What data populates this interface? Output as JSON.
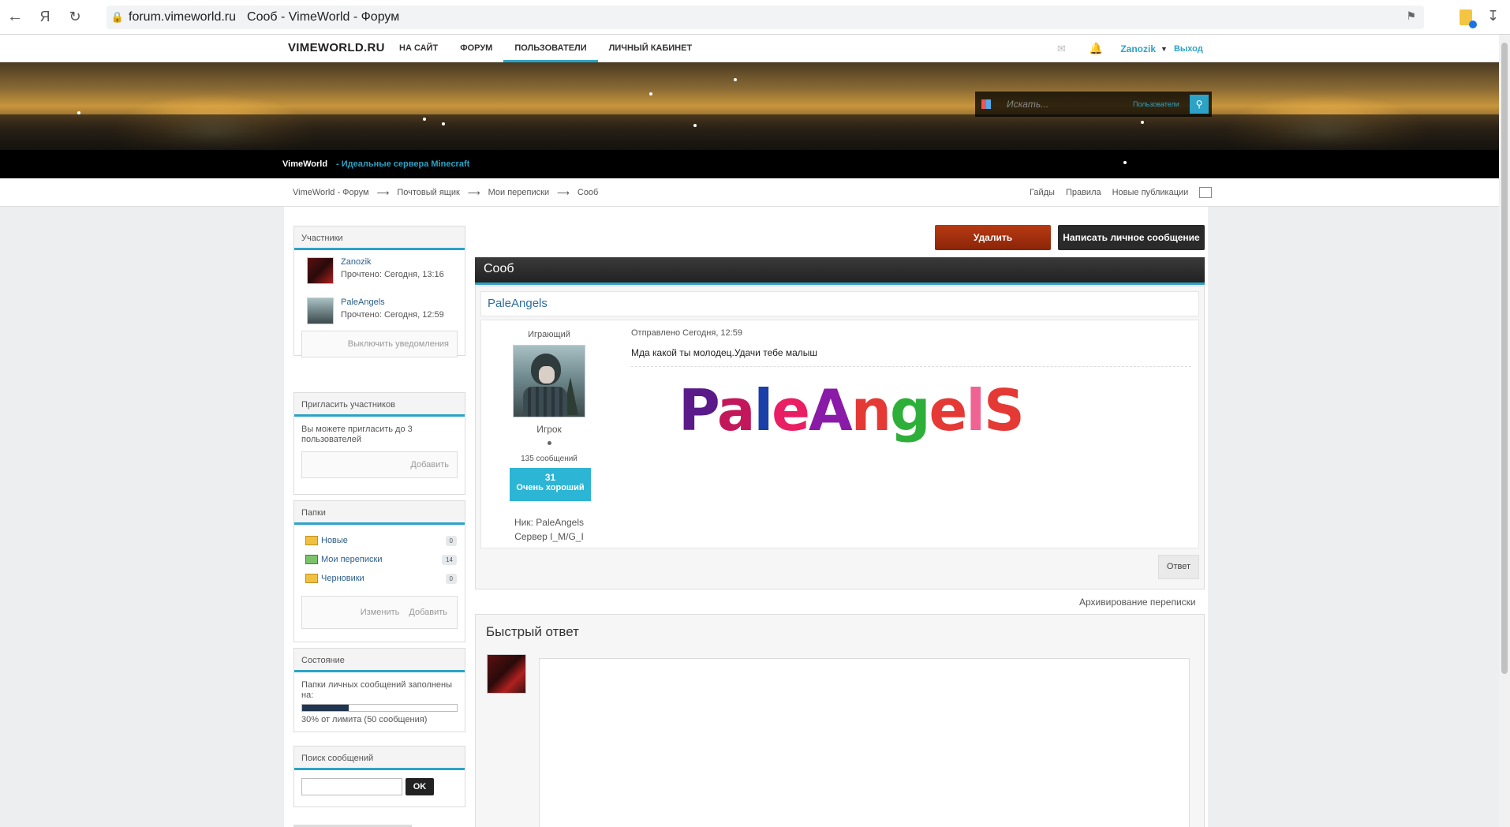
{
  "browser": {
    "domain": "forum.vimeworld.ru",
    "tab_title": "Сооб - VimeWorld - Форум",
    "back_icon": "arrow-left-icon",
    "yandex_icon": "Я",
    "reload_icon": "↻"
  },
  "topnav": {
    "logo": "VIMEWORLD.RU",
    "menu": [
      "НА САЙТ",
      "ФОРУМ",
      "ПОЛЬЗОВАТЕЛИ",
      "ЛИЧНЫЙ КАБИНЕТ"
    ],
    "active_index": 2,
    "username": "Zanozik",
    "logout": "Выход"
  },
  "banner": {
    "search_placeholder": "Искать...",
    "search_scope": "Пользователи",
    "site_name": "VimeWorld",
    "tagline": "- Идеальные сервера Minecraft"
  },
  "breadcrumbs": [
    "VimeWorld - Форум",
    "Почтовый ящик",
    "Мои переписки",
    "Сооб"
  ],
  "breadcrumb_links": [
    "Гайды",
    "Правила",
    "Новые публикации"
  ],
  "sidebar": {
    "participants": {
      "title": "Участники",
      "items": [
        {
          "name": "Zanozik",
          "seen": "Прочтено: Сегодня, 13:16"
        },
        {
          "name": "PaleAngels",
          "seen": "Прочтено: Сегодня, 12:59"
        }
      ],
      "mute_button": "Выключить уведомления"
    },
    "invite": {
      "title": "Пригласить участников",
      "text": "Вы можете пригласить до 3 пользователей",
      "add_button": "Добавить"
    },
    "folders": {
      "title": "Папки",
      "items": [
        {
          "name": "Новые",
          "count": "0"
        },
        {
          "name": "Мои переписки",
          "count": "14"
        },
        {
          "name": "Черновики",
          "count": "0"
        }
      ],
      "edit_button": "Изменить",
      "add_button": "Добавить"
    },
    "status": {
      "title": "Состояние",
      "text": "Папки личных сообщений заполнены на:",
      "percent": 30,
      "limit_text": "30% от лимита (50 сообщения)"
    },
    "search": {
      "title": "Поиск сообщений",
      "ok": "OK"
    }
  },
  "main": {
    "delete_button": "Удалить",
    "pm_button": "Написать личное сообщение",
    "topic_title": "Сооб",
    "post": {
      "author": "PaleAngels",
      "role": "Играющий",
      "group": "Игрок",
      "posts": "135 сообщений",
      "rep_num": "31",
      "rep_label": "Очень хороший",
      "nick": "Ник: PaleAngels",
      "server": "Сервер I_M/G_I",
      "date": "Отправлено Сегодня, 12:59",
      "text": "Мда какой ты молодец.Удачи тебе малыш",
      "art_text": "PaleAngelS",
      "reply": "Ответ"
    },
    "archive": "Архивирование переписки",
    "quick_reply_title": "Быстрый ответ"
  },
  "colors": {
    "accent": "#2ca3c6",
    "delete": "#9a2d0c",
    "link": "#2c5f8a"
  }
}
